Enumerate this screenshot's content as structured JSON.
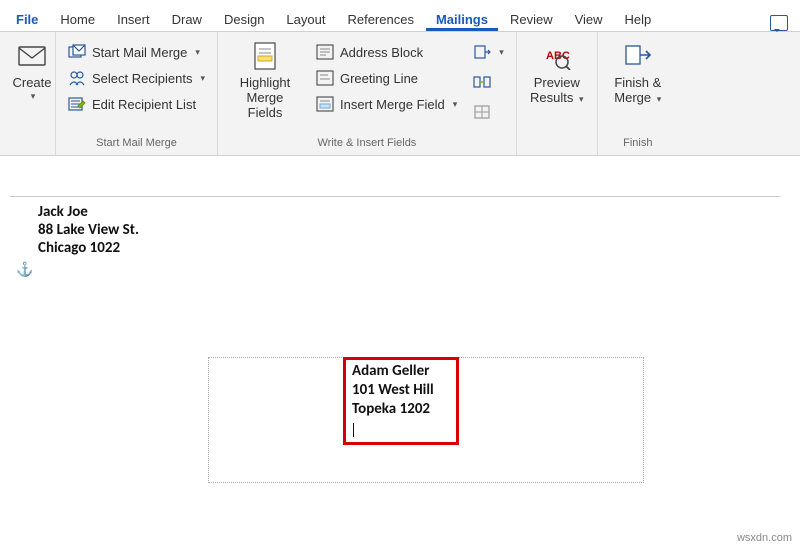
{
  "tabs": {
    "file": "File",
    "home": "Home",
    "insert": "Insert",
    "draw": "Draw",
    "design": "Design",
    "layout": "Layout",
    "references": "References",
    "mailings": "Mailings",
    "review": "Review",
    "view": "View",
    "help": "Help"
  },
  "ribbon": {
    "create": {
      "label1": "Create",
      "dropdown": ""
    },
    "start_merge": {
      "start_mail_merge": "Start Mail Merge",
      "select_recipients": "Select Recipients",
      "edit_recipient_list": "Edit Recipient List",
      "group_label": "Start Mail Merge"
    },
    "write_fields": {
      "highlight_merge_fields_l1": "Highlight",
      "highlight_merge_fields_l2": "Merge Fields",
      "address_block": "Address Block",
      "greeting_line": "Greeting Line",
      "insert_merge_field": "Insert Merge Field",
      "group_label": "Write & Insert Fields"
    },
    "preview": {
      "preview_results_l1": "Preview",
      "preview_results_l2": "Results",
      "group_label": ""
    },
    "finish": {
      "finish_merge_l1": "Finish &",
      "finish_merge_l2": "Merge",
      "group_label": "Finish"
    }
  },
  "document": {
    "return_address": {
      "name": "Jack Joe",
      "street": "88 Lake View St.",
      "city_zip": "Chicago 1022"
    },
    "recipient_address": {
      "name": "Adam Geller",
      "street": "101 West Hill",
      "city_zip": "Topeka 1202"
    }
  },
  "watermark": "wsxdn.com"
}
